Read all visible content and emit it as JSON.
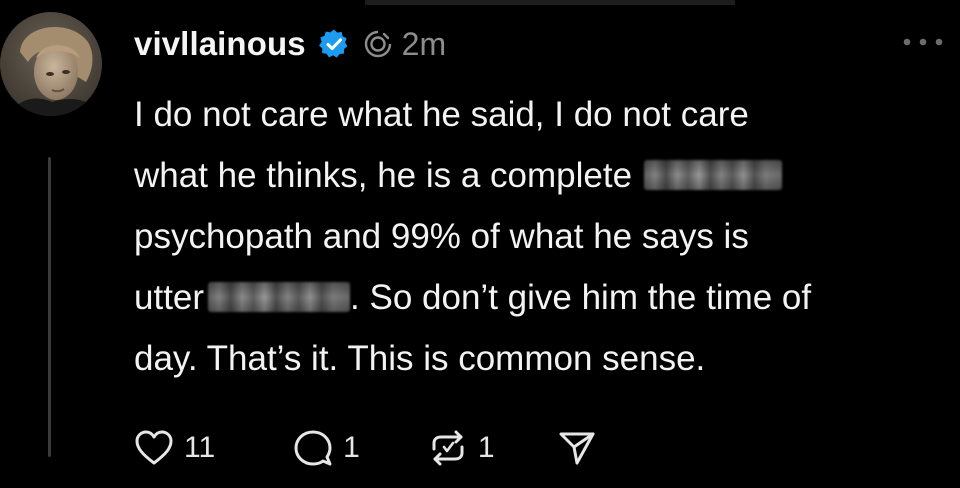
{
  "post": {
    "username": "vivllainous",
    "timestamp": "2m",
    "body_lines": [
      {
        "before": "I do not care what he said, I do not care",
        "after": ""
      },
      {
        "before": "what he thinks, he is a complete",
        "after": ""
      },
      {
        "before": "psychopath and 99% of what he says is",
        "after": ""
      },
      {
        "before": "utter",
        "after": ". So don’t give him the time of"
      },
      {
        "before": "day. That’s it. This is common sense.",
        "after": ""
      }
    ],
    "redactions": [
      "line-2-end",
      "line-4-middle"
    ]
  },
  "icons": {
    "avatar": "profile-photo",
    "verified": "verified-badge-icon",
    "reposted": "reposted-indicator-icon",
    "more": "more-options-icon",
    "like": "heart-icon",
    "reply": "comment-icon",
    "repost": "repost-icon",
    "share": "send-icon"
  },
  "actions": {
    "likes": "11",
    "replies": "1",
    "reposts": "1"
  },
  "colors": {
    "background": "#000000",
    "text": "#f3f3f3",
    "muted": "#8d8d8d",
    "verified": "#1d9bf0",
    "thread_line": "#3a3a3a"
  }
}
